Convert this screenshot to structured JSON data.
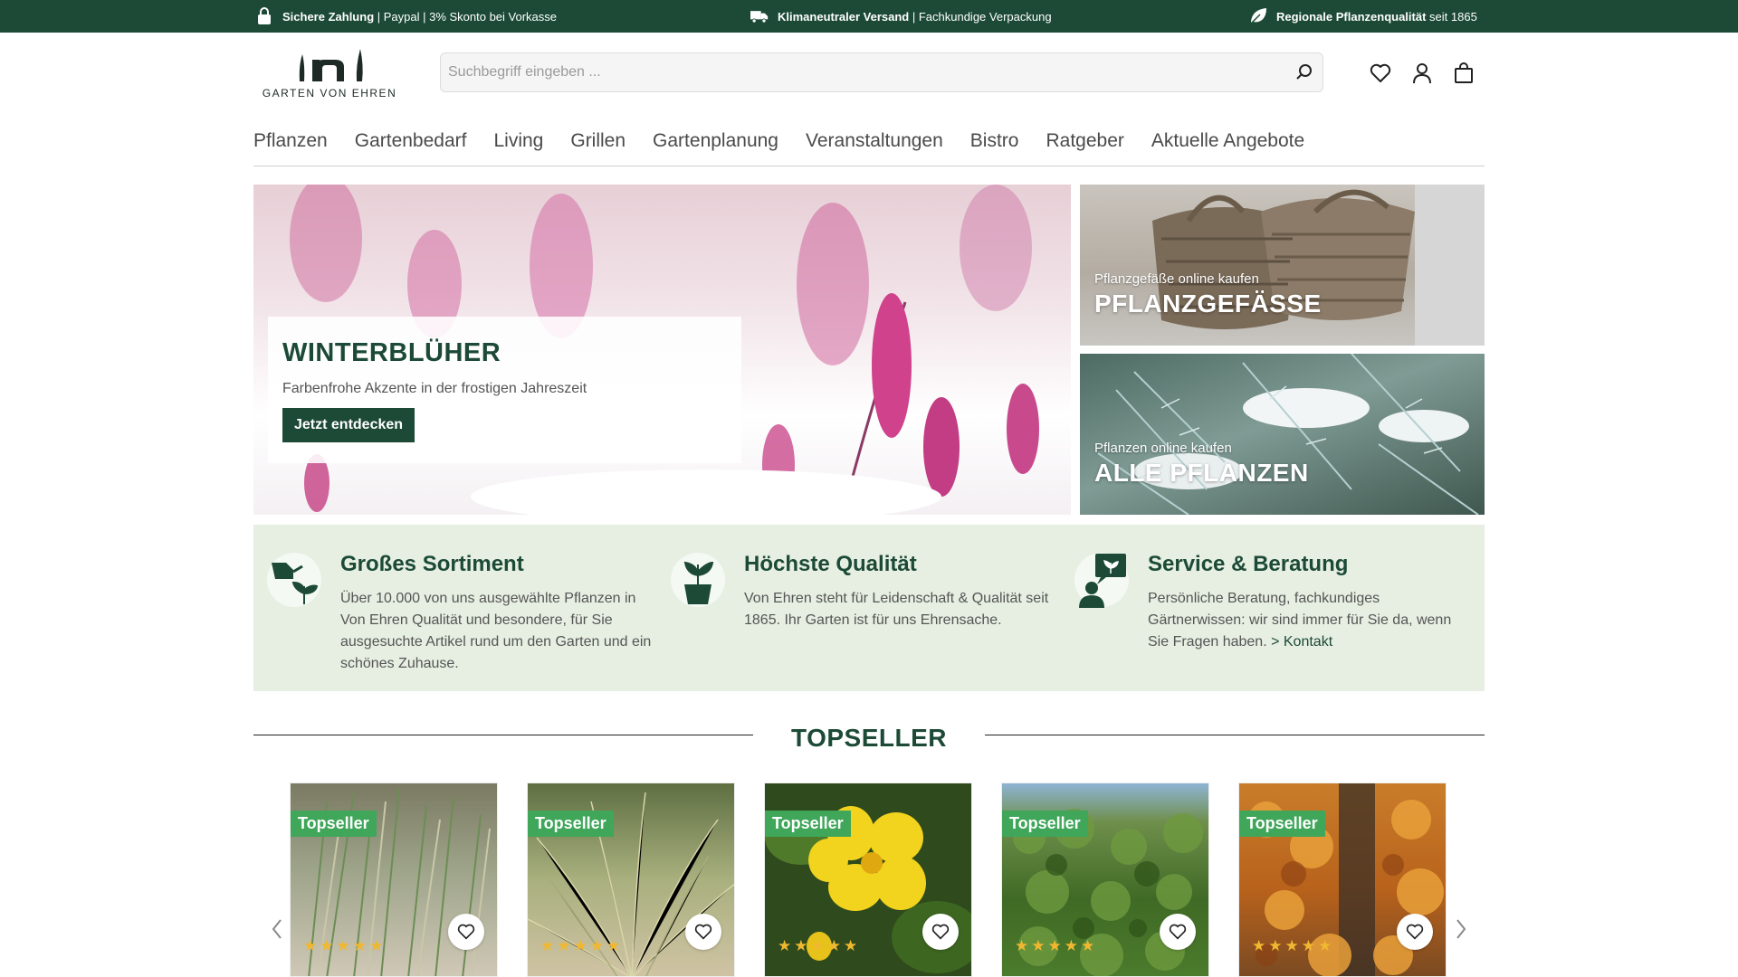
{
  "topbar": {
    "item1_bold": "Sichere Zahlung",
    "item1_rest": " | Paypal | 3% Skonto bei Vorkasse",
    "item1_icon": "lock-icon",
    "item2_bold": "Klimaneutraler Versand",
    "item2_rest": " | Fachkundige Verpackung",
    "item2_icon": "truck-icon",
    "item3_bold": "Regionale Pflanzenqualität",
    "item3_rest": " seit 1865",
    "item3_icon": "leaf-icon"
  },
  "header": {
    "logo_text": "GARTEN VON EHREN",
    "search_placeholder": "Suchbegriff eingeben ...",
    "icons": [
      "search-icon",
      "heart-icon",
      "user-icon",
      "bag-icon"
    ]
  },
  "nav": {
    "items": [
      "Pflanzen",
      "Gartenbedarf",
      "Living",
      "Grillen",
      "Gartenplanung",
      "Veranstaltungen",
      "Bistro",
      "Ratgeber",
      "Aktuelle Angebote"
    ]
  },
  "hero": {
    "title": "WINTERBLÜHER",
    "subtitle": "Farbenfrohe Akzente in der frostigen Jahreszeit",
    "button": "Jetzt entdecken"
  },
  "tiles": [
    {
      "subtitle": "Pflanzgefäße online kaufen",
      "title": "PFLANZGEFÄSSE"
    },
    {
      "subtitle": "Pflanzen online kaufen",
      "title": "ALLE PFLANZEN"
    }
  ],
  "features": [
    {
      "title": "Großes Sortiment",
      "text": "Über 10.000 von uns ausgewählte Pflanzen in Von Ehren Qualität und besondere, für Sie ausgesuchte Artikel rund um den Garten und ein schönes Zuhause.",
      "link": ""
    },
    {
      "title": "Höchste Qualität",
      "text": "Von Ehren steht für Leidenschaft & Qualität seit 1865. Ihr Garten ist für uns Ehrensache.",
      "link": ""
    },
    {
      "title": "Service & Beratung",
      "text": "Persönliche Beratung, fachkundiges Gärtnerwissen: wir sind immer für Sie da, wenn Sie Fragen haben. ",
      "link": "> Kontakt"
    }
  ],
  "topseller": {
    "title": "TOPSELLER",
    "badge": "Topseller",
    "products": [
      {
        "rating": 4.5
      },
      {
        "rating": 5
      },
      {
        "rating": 5
      },
      {
        "rating": 5
      },
      {
        "rating": 4.5
      }
    ]
  },
  "colors": {
    "brand_green": "#1c4a37",
    "badge_green": "#3fa65a",
    "feature_bg": "#e6efe2",
    "star": "#f0b830"
  }
}
